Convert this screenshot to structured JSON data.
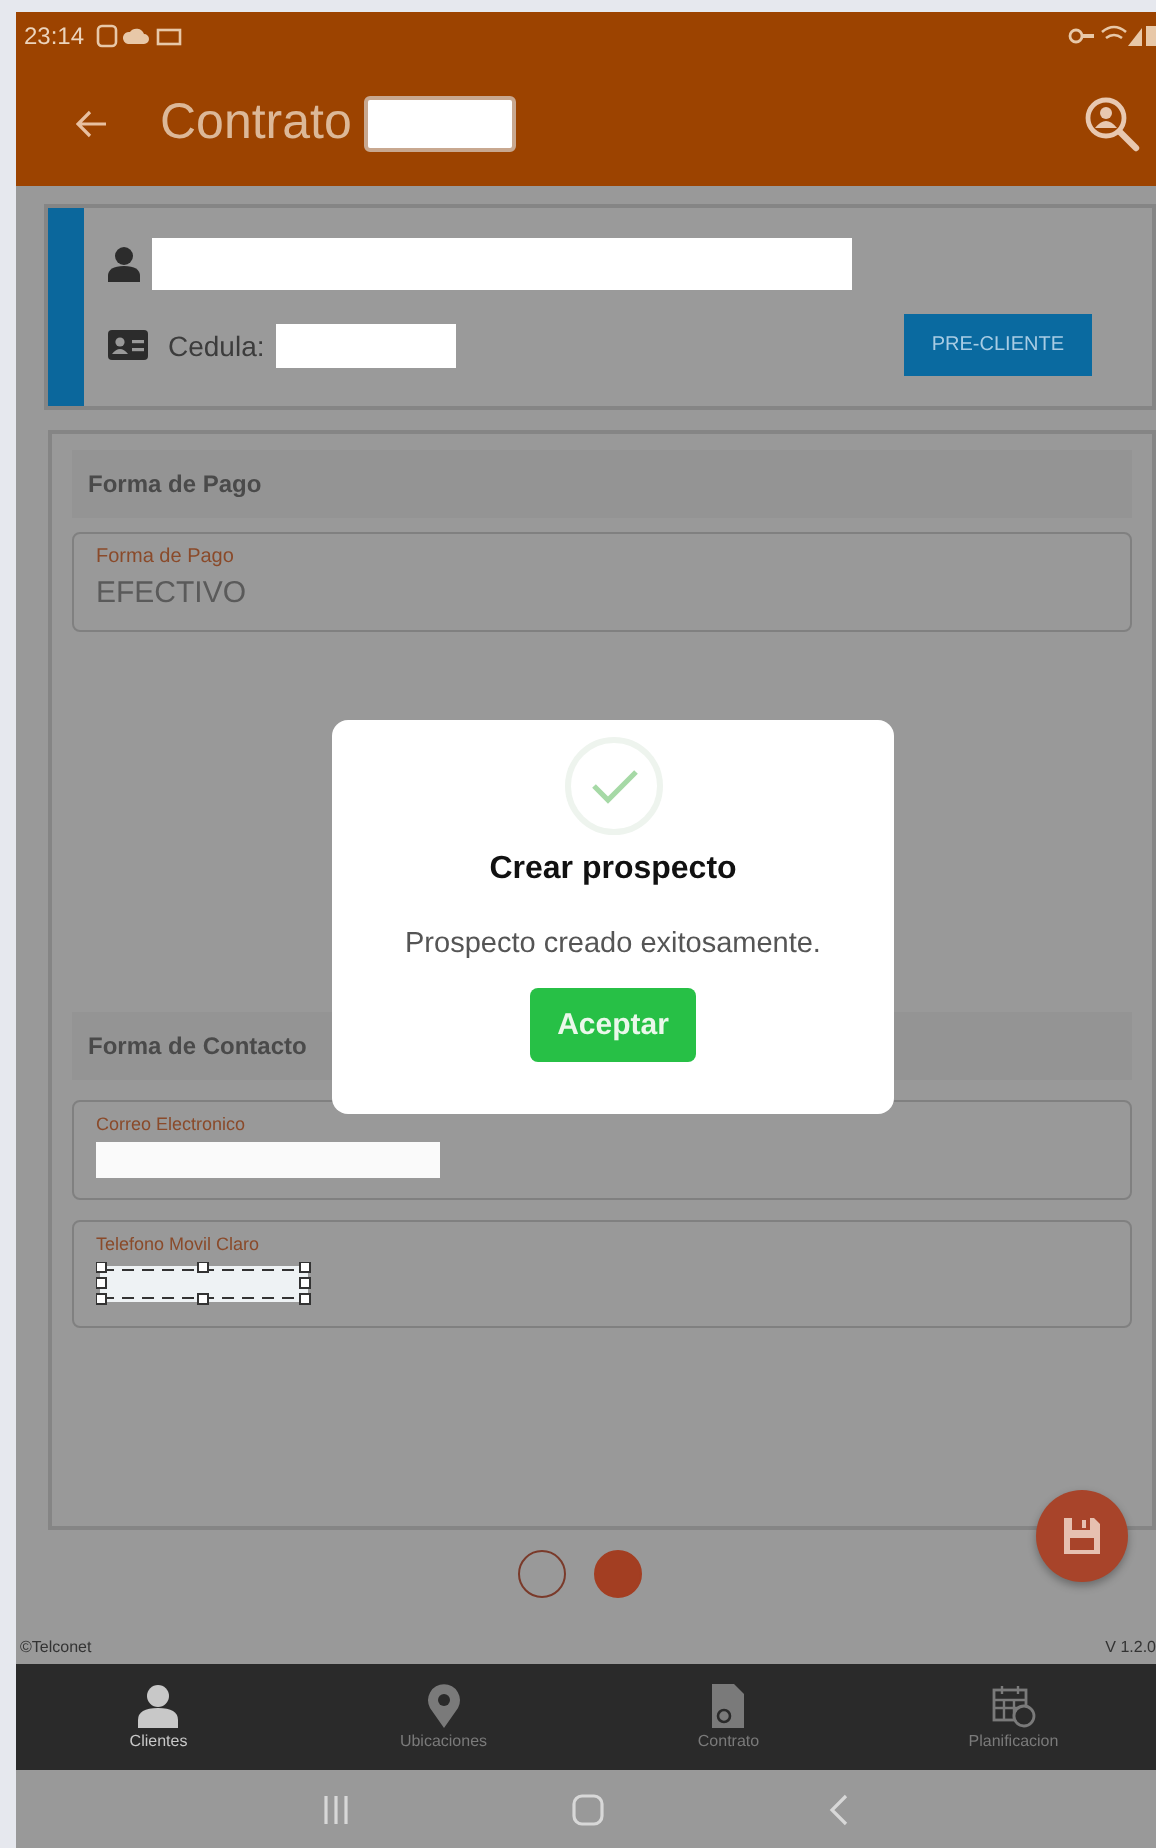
{
  "status_bar": {
    "time": "23:14"
  },
  "app_bar": {
    "title": "Contrato"
  },
  "client_card": {
    "id_label": "Cedula:",
    "button": "PRE-CLIENTE"
  },
  "sections": [
    {
      "title": "Forma de Pago",
      "fields": [
        {
          "label": "Forma de Pago",
          "kind": "value",
          "value": "EFECTIVO"
        }
      ]
    },
    {
      "title": "Forma de Contacto",
      "fields": [
        {
          "label": "Correo Electronico",
          "kind": "blank"
        },
        {
          "label": "Telefono Movil Claro",
          "kind": "selection"
        }
      ]
    }
  ],
  "dialog": {
    "title": "Crear prospecto",
    "message": "Prospecto creado exitosamente.",
    "button": "Aceptar"
  },
  "pager": [
    {
      "selected": false
    },
    {
      "selected": true
    }
  ],
  "footer": {
    "copyright": "©Telconet",
    "version": "V 1.2.0"
  },
  "bottom_nav": [
    {
      "label": "Clientes",
      "selected": true
    },
    {
      "label": "Ubicaciones",
      "selected": false
    },
    {
      "label": "Contrato",
      "selected": false
    },
    {
      "label": "Planificacion",
      "selected": false
    }
  ]
}
